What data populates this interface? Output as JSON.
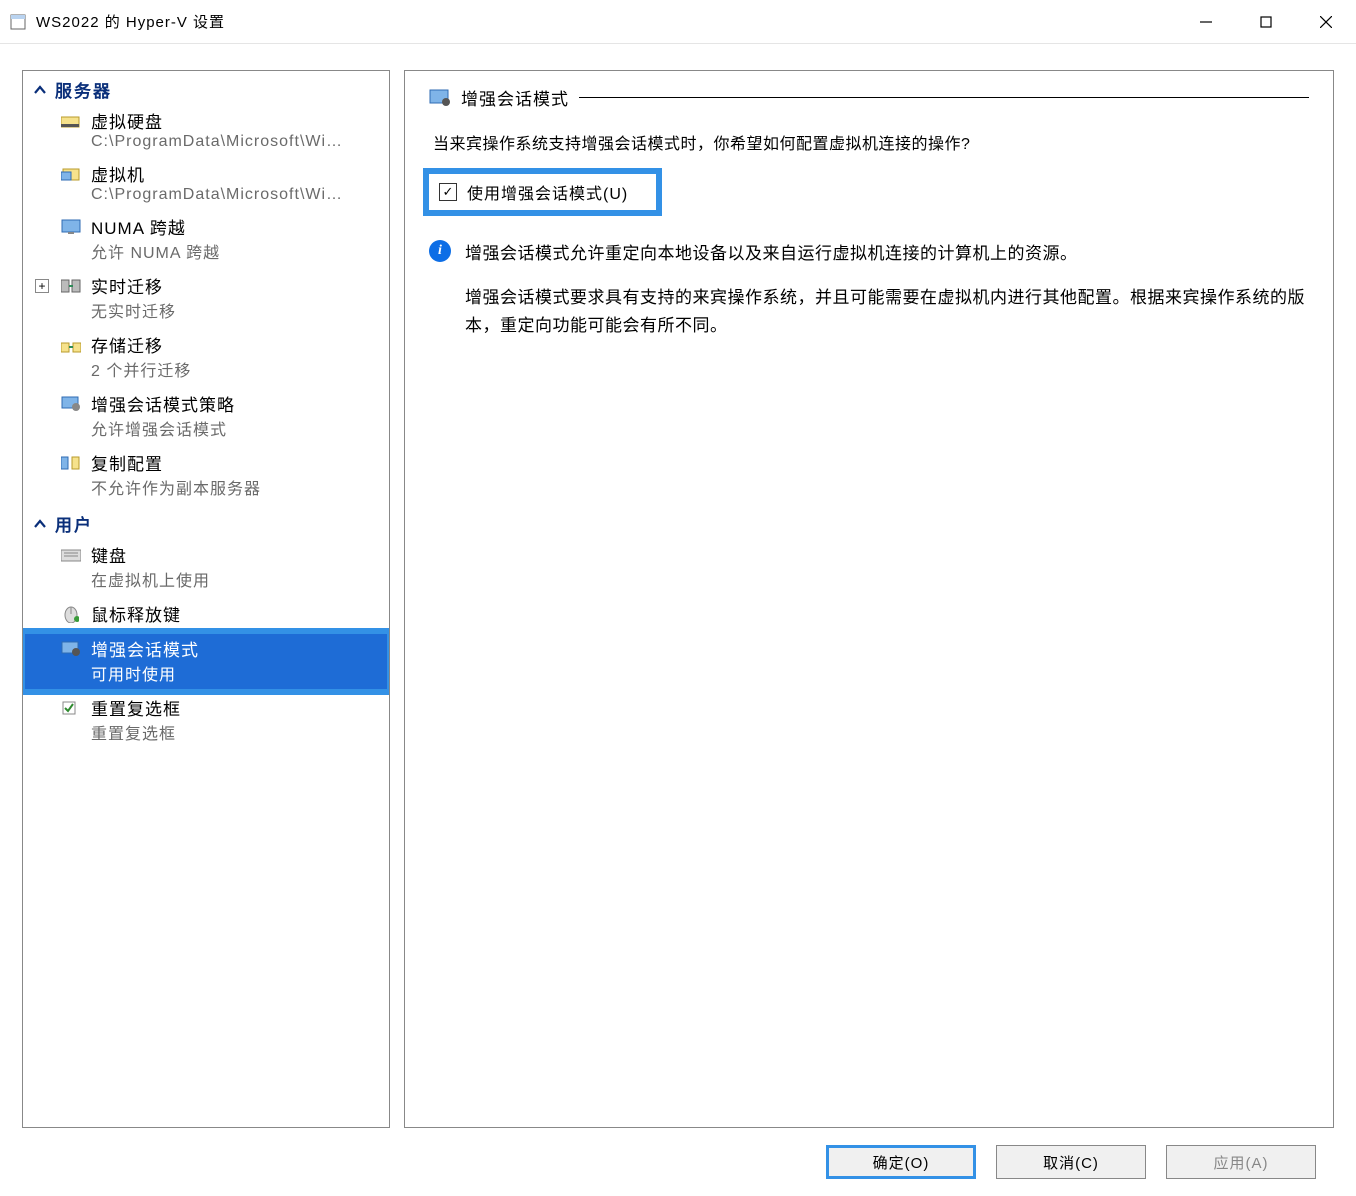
{
  "window": {
    "title": "WS2022 的 Hyper-V 设置"
  },
  "sidebar": {
    "sections": [
      {
        "title": "服务器",
        "items": [
          {
            "label": "虚拟硬盘",
            "sub": "C:\\ProgramData\\Microsoft\\Windo..."
          },
          {
            "label": "虚拟机",
            "sub": "C:\\ProgramData\\Microsoft\\Windo..."
          },
          {
            "label": "NUMA 跨越",
            "sub": "允许 NUMA 跨越"
          },
          {
            "label": "实时迁移",
            "sub": "无实时迁移",
            "expandable": true
          },
          {
            "label": "存储迁移",
            "sub": "2 个并行迁移"
          },
          {
            "label": "增强会话模式策略",
            "sub": "允许增强会话模式"
          },
          {
            "label": "复制配置",
            "sub": "不允许作为副本服务器"
          }
        ]
      },
      {
        "title": "用户",
        "items": [
          {
            "label": "键盘",
            "sub": "在虚拟机上使用"
          },
          {
            "label": "鼠标释放键",
            "sub": ""
          },
          {
            "label": "增强会话模式",
            "sub": "可用时使用",
            "selected": true
          },
          {
            "label": "重置复选框",
            "sub": "重置复选框"
          }
        ]
      }
    ]
  },
  "detail": {
    "title": "增强会话模式",
    "question": "当来宾操作系统支持增强会话模式时，你希望如何配置虚拟机连接的操作?",
    "checkbox_label": "使用增强会话模式(U)",
    "info_p1": "增强会话模式允许重定向本地设备以及来自运行虚拟机连接的计算机上的资源。",
    "info_p2": "增强会话模式要求具有支持的来宾操作系统，并且可能需要在虚拟机内进行其他配置。根据来宾操作系统的版本，重定向功能可能会有所不同。"
  },
  "buttons": {
    "ok": "确定(O)",
    "cancel": "取消(C)",
    "apply": "应用(A)"
  }
}
